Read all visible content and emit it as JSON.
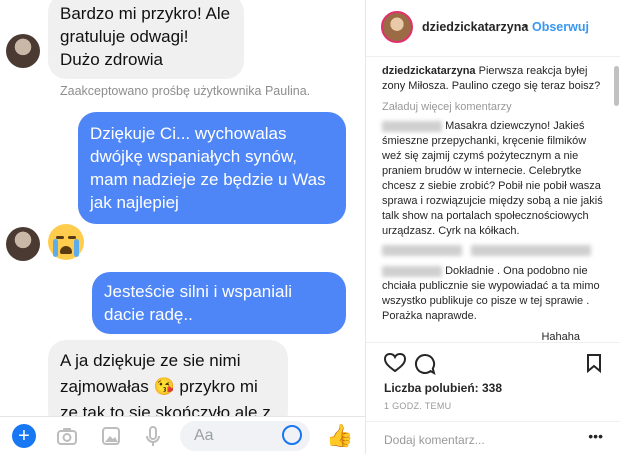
{
  "messenger": {
    "messages": [
      {
        "dir": "in",
        "text": "Bardzo mi przykro! Ale gratuluje odwagi! Dużo zdrowia"
      },
      {
        "dir": "out",
        "text": "Dziękuje Ci... wychowalas dwójkę wspaniałych synów, mam nadzieje ze będzie u Was jak najlepiej"
      },
      {
        "dir": "out",
        "text": "Jesteście silni i wspaniali dacie radę.."
      },
      {
        "dir": "in",
        "text": "A ja dziękuje ze sie nimi zajmowałas 😘 przykro mi ze tak to sie skończyło ale z"
      }
    ],
    "system_note": "Zaakceptowano prośbę użytkownika Paulina.",
    "reaction_emoji": "crying-face-icon",
    "composer": {
      "placeholder": "Aa",
      "icons": [
        "plus-icon",
        "camera-icon",
        "gallery-icon",
        "microphone-icon",
        "smiley-icon",
        "thumbs-up-icon"
      ],
      "accent": "#1877f2"
    },
    "outgoing_color": "#4f86f7",
    "incoming_color": "#f1f0f0"
  },
  "instagram": {
    "username": "dziedzickatarzyna",
    "follow_label": "Obserwuj",
    "caption": "Pierwsza reakcja byłej zony Miłosza. Paulino czego się teraz boisz?",
    "load_more": "Załaduj więcej komentarzy",
    "comments": [
      {
        "text": "Masakra dziewczyno! Jakieś śmieszne przepychanki, kręcenie filmików weź się zajmij czymś pożytecznym a nie praniem brudów w internecie. Celebrytke chcesz z siebie zrobić? Pobił nie pobił wasza sprawa i rozwiązujcie między sobą a nie jakiś talk show na portalach społecznościowych urządzasz. Cyrk na kółkach."
      },
      {
        "text": "Dokładnie . Ona podobno nie chciała publicznie sie wypowiadać a ta mimo wszystko publikuje co pisze w tej sprawie . Porażka naprawde."
      },
      {
        "text": "Hahaha"
      }
    ],
    "likes": "Liczba polubień: 338",
    "time": "1 GODZ. TEMU",
    "add_comment": "Dodaj komentarz...",
    "more": "•••",
    "accent": "#3897f0"
  }
}
